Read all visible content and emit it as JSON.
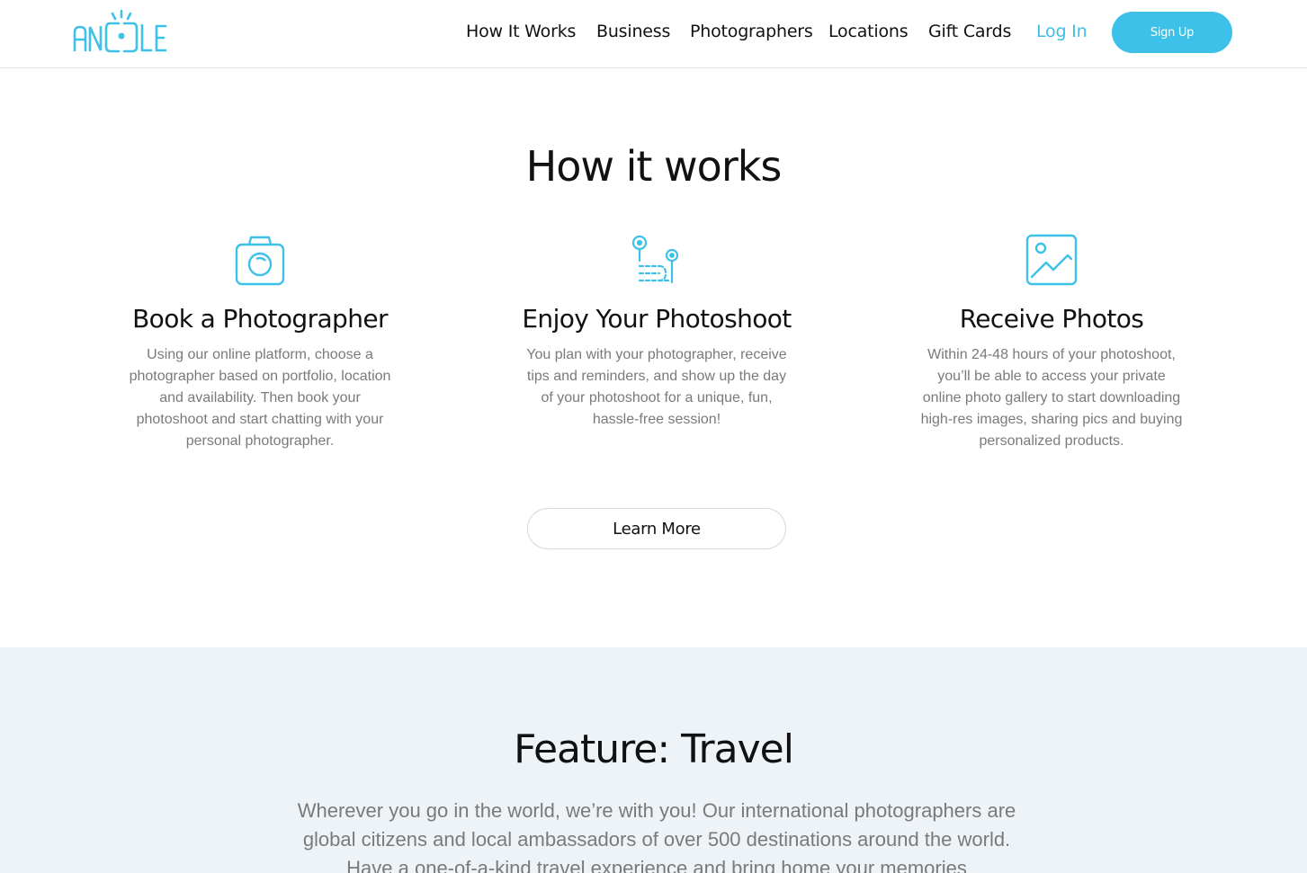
{
  "brand": {
    "logo_text": "ANGLE",
    "accent": "#40bde6"
  },
  "nav": {
    "items": [
      "How It Works",
      "Business",
      "Photographers",
      "Locations",
      "Gift Cards"
    ],
    "login": "Log In",
    "signup": "Sign Up"
  },
  "how_it_works": {
    "title": "How it works",
    "steps": [
      {
        "icon": "camera-icon",
        "title": "Book a Photographer",
        "text": "Using our online platform, choose a photographer based on portfolio, location and availability. Then book your photoshoot and start chatting with your personal photographer."
      },
      {
        "icon": "route-pins-icon",
        "title": "Enjoy Your Photoshoot",
        "text": "You plan with your photographer, receive tips and reminders, and show up the day of your photoshoot for a unique, fun, hassle-free session!"
      },
      {
        "icon": "image-icon",
        "title": "Receive Photos",
        "text": "Within 24-48 hours of your photoshoot, you’ll be able to access your private online photo gallery to start downloading high-res images, sharing pics and buying personalized products."
      }
    ],
    "learn_more": "Learn More"
  },
  "feature": {
    "title": "Feature: Travel",
    "text": "Wherever you go in the world, we’re with you! Our international photographers are global citizens and local ambassadors of over 500 destinations around the world. Have a one-of-a-kind travel experience and bring home your memories"
  }
}
